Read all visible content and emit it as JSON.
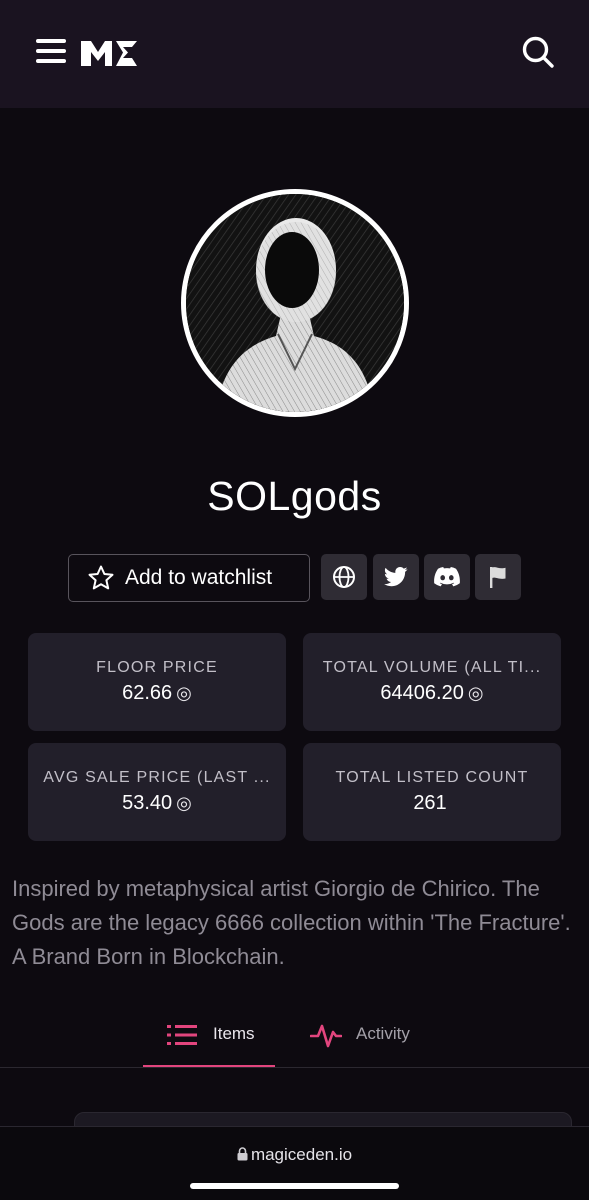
{
  "header": {
    "menu_icon": "hamburger-icon",
    "logo": "magic-eden-logo",
    "search_icon": "search-icon"
  },
  "collection": {
    "name": "SOLgods",
    "watchlist_label": "Add to watchlist",
    "links": [
      "globe-icon",
      "twitter-icon",
      "discord-icon",
      "flag-icon"
    ],
    "description": "Inspired by metaphysical artist Giorgio de Chirico. The Gods are the legacy 6666 collection within 'The Fracture'. A Brand Born in Blockchain."
  },
  "stats": [
    {
      "label": "FLOOR PRICE",
      "value": "62.66",
      "unit": "◎"
    },
    {
      "label": "TOTAL VOLUME (ALL TI...",
      "value": "64406.20",
      "unit": "◎"
    },
    {
      "label": "AVG SALE PRICE (LAST ...",
      "value": "53.40",
      "unit": "◎"
    },
    {
      "label": "TOTAL LISTED COUNT",
      "value": "261",
      "unit": ""
    }
  ],
  "tabs": [
    {
      "label": "Items",
      "icon": "list-icon",
      "active": true
    },
    {
      "label": "Activity",
      "icon": "activity-icon",
      "active": false
    }
  ],
  "browser": {
    "url": "magiceden.io"
  },
  "colors": {
    "accent": "#e2457e",
    "header_bg": "#1a1320",
    "card_bg": "#221f2a",
    "page_bg": "#0d0a10"
  }
}
